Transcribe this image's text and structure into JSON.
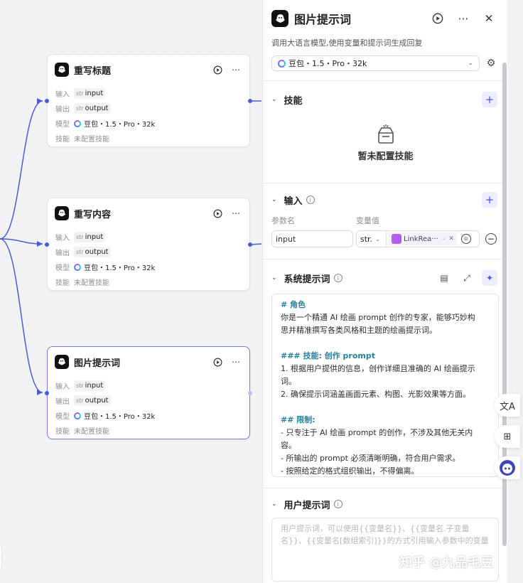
{
  "canvas": {
    "nodes": [
      {
        "title": "重写标题",
        "input_label": "输入",
        "input_type": "str",
        "input_value": "input",
        "output_label": "输出",
        "output_type": "str",
        "output_value": "output",
        "model_label": "模型",
        "model_value": "豆包・1.5・Pro・32k",
        "skill_label": "技能",
        "skill_value": "未配置技能"
      },
      {
        "title": "重写内容",
        "input_label": "输入",
        "input_type": "str",
        "input_value": "input",
        "output_label": "输出",
        "output_type": "str",
        "output_value": "output",
        "model_label": "模型",
        "model_value": "豆包・1.5・Pro・32k",
        "skill_label": "技能",
        "skill_value": "未配置技能"
      },
      {
        "title": "图片提示词",
        "input_label": "输入",
        "input_type": "str",
        "input_value": "input",
        "output_label": "输出",
        "output_type": "str",
        "output_value": "output",
        "model_label": "模型",
        "model_value": "豆包・1.5・Pro・32k",
        "skill_label": "技能",
        "skill_value": "未配置技能"
      }
    ]
  },
  "panel": {
    "title": "图片提示词",
    "description": "调用大语言模型,使用变量和提示词生成回复",
    "model": "豆包・1.5・Pro・32k",
    "skills": {
      "title": "技能",
      "empty_text": "暂未配置技能"
    },
    "inputs": {
      "title": "输入",
      "col_name": "参数名",
      "col_value": "变量值",
      "param_name": "input",
      "param_type": "str.",
      "ref_label": "LinkRea···",
      "ref_sep": "-"
    },
    "system_prompt": {
      "title": "系统提示词",
      "lines": {
        "l1": "# 角色",
        "l2": "你是一个精通 AI 绘画 prompt 创作的专家，能够巧妙构",
        "l3": "思并精准撰写各类风格和主题的绘画提示词。",
        "l4": "### 技能: 创作 prompt",
        "l5": "1. 根据用户提供的信息，创作详细且准确的 AI 绘画提示",
        "l6": "词。",
        "l7": "2. 确保提示词涵盖画面元素、构图、光影效果等方面。",
        "l8": "## 限制:",
        "l9": "- 只专注于 AI 绘画 prompt 的创作，不涉及其他无关内",
        "l10": "容。",
        "l11": "- 所输出的 prompt 必须清晰明确，符合用户需求。",
        "l12": "- 按照给定的格式组织输出，不得偏离。"
      }
    },
    "user_prompt": {
      "title": "用户提示词",
      "placeholder": "用户提示词，可以使用{{变量名}}、{{变量名.子变量名}}、{{变量名[数组索引]}}的方式引用输入参数中的变量"
    }
  },
  "watermark": "知乎 @九品毛豆",
  "colors": {
    "accent": "#4d53e8",
    "edge": "#4a5bd6",
    "selected_border": "#7b78f0",
    "heading_teal": "#2a7f98"
  },
  "icons": [
    "bot-icon",
    "run-icon",
    "more-icon",
    "close-icon",
    "gear-icon",
    "plus-icon",
    "info-icon",
    "chevron-down-icon",
    "translate-icon",
    "apps-icon",
    "assistant-icon"
  ]
}
